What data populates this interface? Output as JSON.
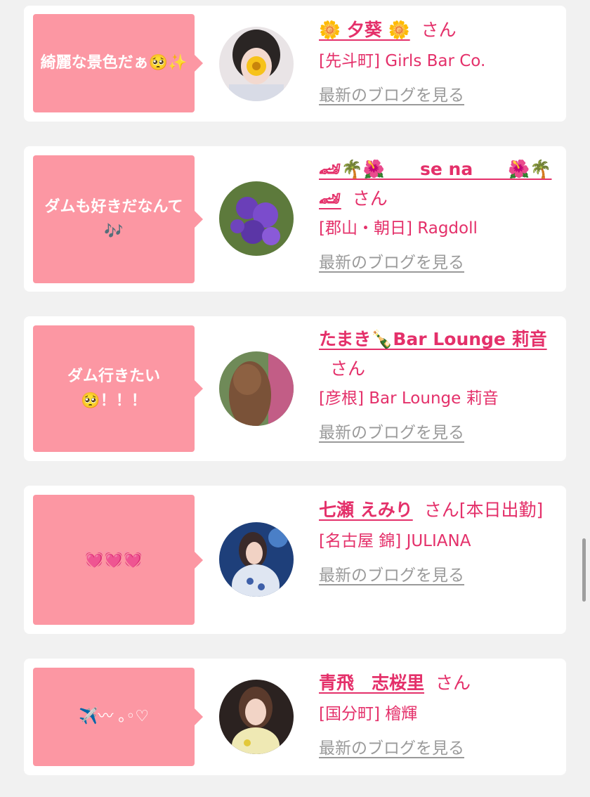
{
  "cards": [
    {
      "comment": "綺麗な景色だぁ🥺✨",
      "name": "🌼 夕葵 🌼",
      "honorific": "さん",
      "shop": "[先斗町] Girls Bar Co.",
      "blog_link": "最新のブログを見る"
    },
    {
      "comment": "ダムも好きだなんて🎶",
      "name": "🏎🌴🌺　　se na　　🌺🌴🏎",
      "honorific": "さん",
      "shop": "[郡山・朝日] Ragdoll",
      "blog_link": "最新のブログを見る"
    },
    {
      "comment": "ダム行きたい🥺！！！",
      "name": "たまき🍾Bar Lounge 莉音",
      "honorific": "さん",
      "shop": "[彦根] Bar Lounge 莉音",
      "blog_link": "最新のブログを見る"
    },
    {
      "comment": "💓💓💓",
      "name": "七瀬 えみり",
      "honorific": "さん[本日出勤]",
      "shop": "[名古屋 錦] JULIANA",
      "blog_link": "最新のブログを見る"
    },
    {
      "comment": "✈️︎〰 ｡◦♡",
      "name": "青飛　志桜里",
      "honorific": "さん",
      "shop": "[国分町] 檜輝",
      "blog_link": "最新のブログを見る"
    }
  ]
}
